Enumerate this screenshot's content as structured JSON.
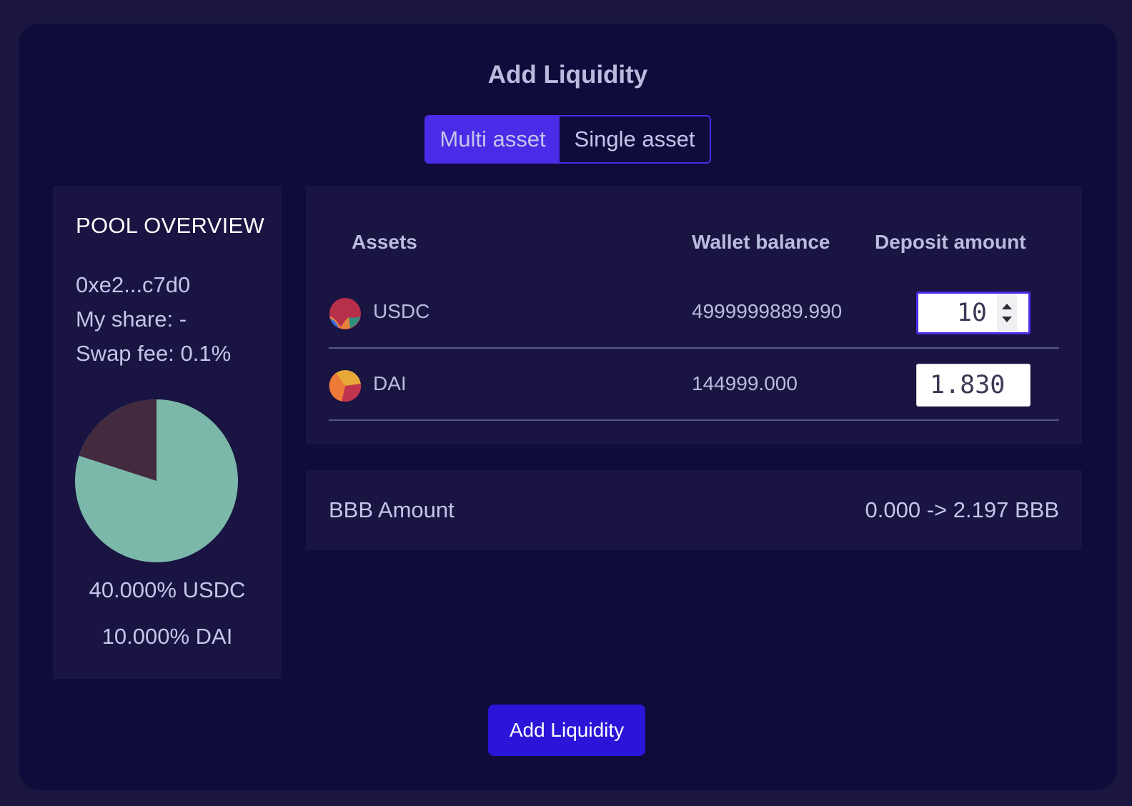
{
  "modal": {
    "title": "Add Liquidity",
    "tabs": [
      {
        "label": "Multi asset",
        "active": true
      },
      {
        "label": "Single asset",
        "active": false
      }
    ]
  },
  "overview": {
    "heading": "POOL OVERVIEW",
    "address": "0xe2...c7d0",
    "my_share": "My share: -",
    "swap_fee": "Swap fee: 0.1%",
    "weights": [
      {
        "label": "40.000% USDC",
        "color": "#7bb8aa"
      },
      {
        "label": "10.000% DAI",
        "color": "#432a3e"
      }
    ]
  },
  "assets_table": {
    "headers": {
      "assets": "Assets",
      "wallet_balance": "Wallet balance",
      "deposit_amount": "Deposit amount"
    },
    "rows": [
      {
        "symbol": "USDC",
        "balance": "4999999889.990",
        "deposit": "10",
        "icon": "usdc-token-icon"
      },
      {
        "symbol": "DAI",
        "balance": "144999.000",
        "deposit": "1.830",
        "icon": "dai-token-icon"
      }
    ]
  },
  "bbb": {
    "label": "BBB Amount",
    "value": "0.000 -> 2.197 BBB"
  },
  "submit": {
    "label": "Add Liquidity"
  },
  "colors": {
    "accent": "#4a2be8",
    "button": "#2a15d8",
    "background": "#0f0b3a",
    "panel": "#191441"
  }
}
